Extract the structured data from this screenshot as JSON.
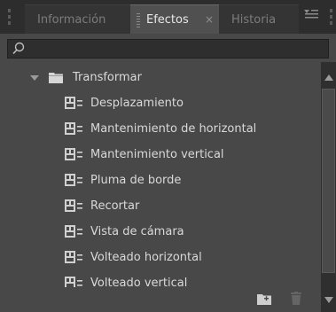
{
  "tabs": [
    {
      "label": "Información",
      "active": false
    },
    {
      "label": "Efectos",
      "active": true,
      "close": "×"
    },
    {
      "label": "Historia",
      "active": false
    }
  ],
  "panel_menu_icon": "panel-menu-icon",
  "search": {
    "placeholder": "",
    "value": ""
  },
  "tree": {
    "folder": {
      "label": "Transformar",
      "expanded": true
    },
    "items": [
      {
        "label": "Desplazamiento"
      },
      {
        "label": "Mantenimiento de horizontal"
      },
      {
        "label": "Mantenimiento vertical"
      },
      {
        "label": "Pluma de borde"
      },
      {
        "label": "Recortar"
      },
      {
        "label": "Vista de cámara"
      },
      {
        "label": "Volteado horizontal"
      },
      {
        "label": "Volteado vertical"
      }
    ]
  },
  "colors": {
    "panel_bg": "#484848",
    "tab_active_bg": "#505050",
    "text": "#d9d9d9",
    "tab_inactive_text": "#7c7c7c"
  }
}
